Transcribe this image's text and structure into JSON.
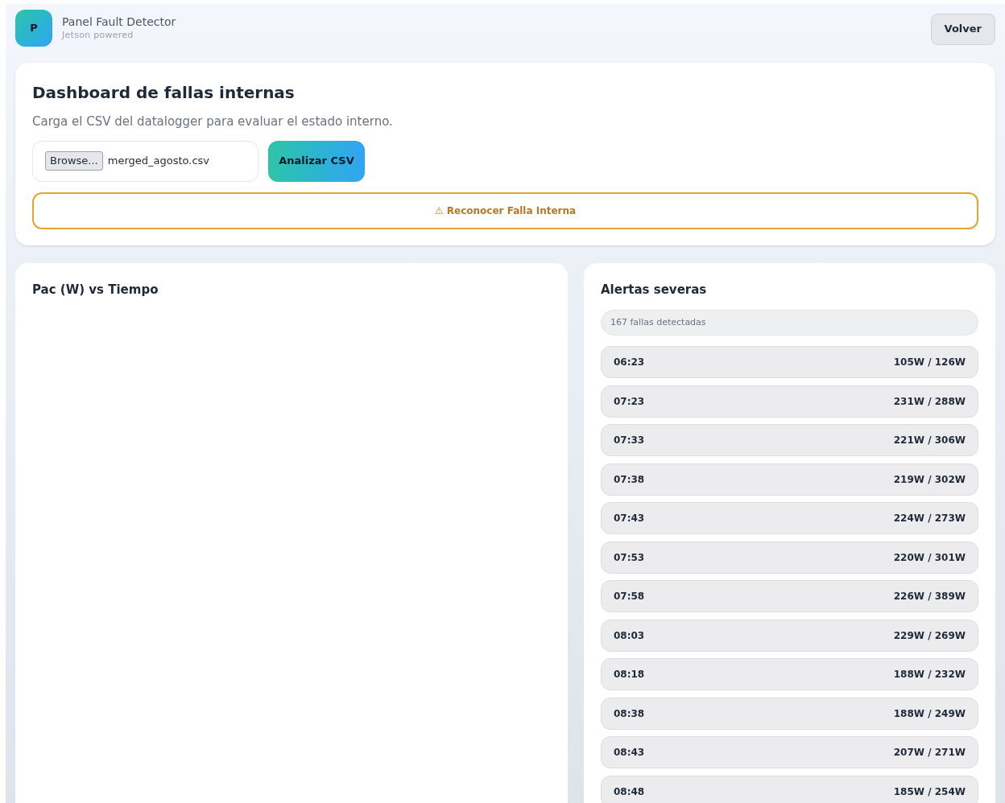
{
  "header": {
    "logo": "P",
    "title": "Panel Fault Detector",
    "subtitle": "Jetson powered",
    "back_button": "Volver"
  },
  "upload_card": {
    "title": "Dashboard de fallas internas",
    "description": "Carga el CSV del datalogger para evaluar el estado interno.",
    "file_button": "Browse...",
    "file_name": "merged_agosto.csv",
    "analyze_button": "Analizar CSV",
    "recognize_button": "⚠ Reconocer Falla Interna"
  },
  "chart_card": {
    "title": "Pac (W) vs Tiempo"
  },
  "alerts_card": {
    "title": "Alertas severas",
    "count": "167 fallas detectadas",
    "alerts": [
      {
        "time": "06:23",
        "power": "105W / 126W"
      },
      {
        "time": "07:23",
        "power": "231W / 288W"
      },
      {
        "time": "07:33",
        "power": "221W / 306W"
      },
      {
        "time": "07:38",
        "power": "219W / 302W"
      },
      {
        "time": "07:43",
        "power": "224W / 273W"
      },
      {
        "time": "07:53",
        "power": "220W / 301W"
      },
      {
        "time": "07:58",
        "power": "226W / 389W"
      },
      {
        "time": "08:03",
        "power": "229W / 269W"
      },
      {
        "time": "08:18",
        "power": "188W / 232W"
      },
      {
        "time": "08:38",
        "power": "188W / 249W"
      },
      {
        "time": "08:43",
        "power": "207W / 271W"
      },
      {
        "time": "08:48",
        "power": "185W / 254W"
      }
    ]
  }
}
